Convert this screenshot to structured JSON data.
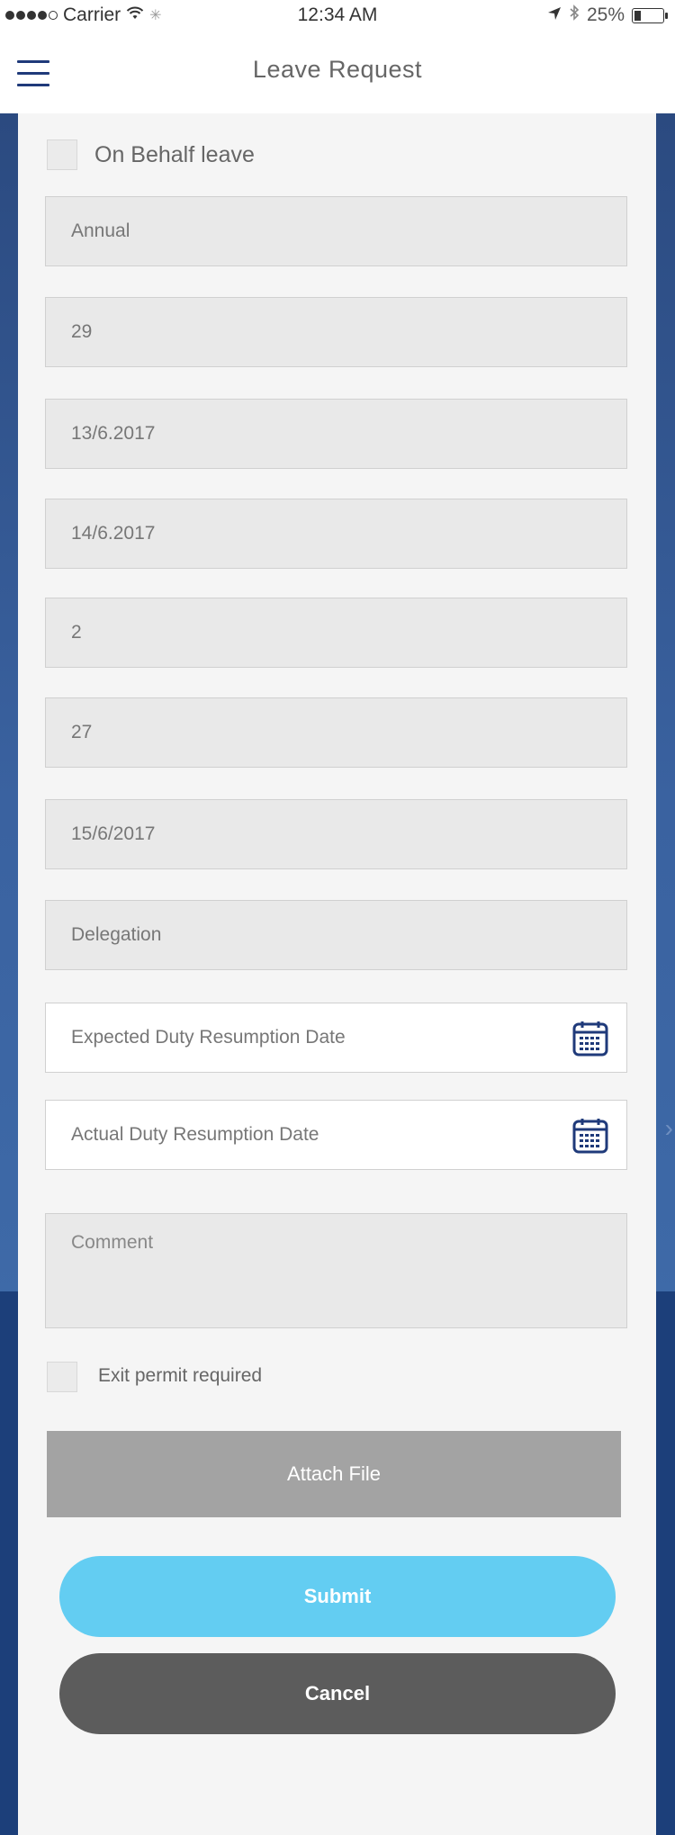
{
  "status_bar": {
    "carrier": "Carrier",
    "time": "12:34 AM",
    "battery": "25%",
    "battery_level": 0.25
  },
  "nav": {
    "title": "Leave Request",
    "menu_icon": "hamburger-menu-icon"
  },
  "form": {
    "on_behalf_label": "On Behalf leave",
    "leave_type": "Annual",
    "balance": "29",
    "start_date": "13/6.2017",
    "end_date": "14/6.2017",
    "days": "2",
    "remaining": "27",
    "return_date": "15/6/2017",
    "delegation": "Delegation",
    "expected_resumption_placeholder": "Expected Duty Resumption Date",
    "actual_resumption_placeholder": "Actual Duty Resumption Date",
    "comment_placeholder": "Comment",
    "exit_permit_label": "Exit permit required",
    "calendar_icon": "calendar-icon"
  },
  "buttons": {
    "attach": "Attach File",
    "submit": "Submit",
    "cancel": "Cancel"
  },
  "colors": {
    "accent": "#63cdf2",
    "navy": "#1f3a7a",
    "cancel": "#5c5c5c",
    "attach": "#a3a3a3"
  }
}
